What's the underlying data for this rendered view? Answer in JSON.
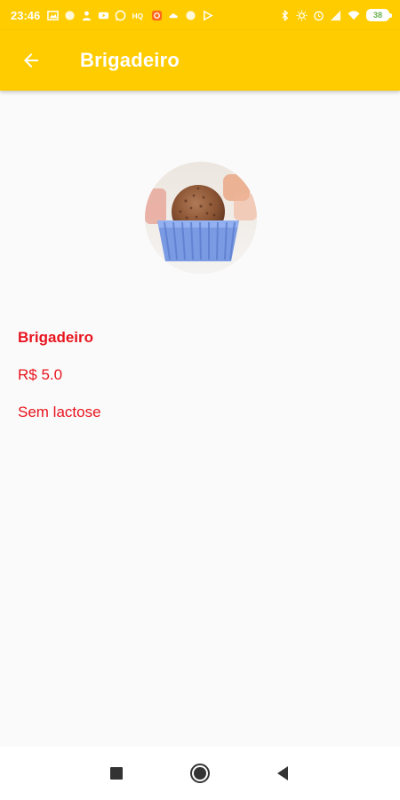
{
  "status_bar": {
    "time": "23:46",
    "battery": "38"
  },
  "toolbar": {
    "title": "Brigadeiro"
  },
  "product": {
    "name": "Brigadeiro",
    "price": "R$ 5.0",
    "description": "Sem lactose"
  },
  "colors": {
    "accent": "#ffcc00",
    "text_red": "#e8141e"
  },
  "icons": {
    "back": "arrow-left-icon",
    "recents": "square-icon",
    "home": "circle-icon",
    "back_nav": "triangle-left-icon"
  }
}
